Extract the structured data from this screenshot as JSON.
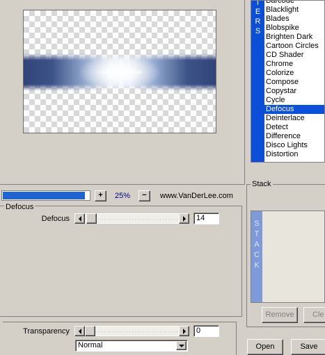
{
  "preview": {
    "band_colors": {
      "dark": "#31447a",
      "mid": "#8aa0c8",
      "highlight": "#ffffff"
    }
  },
  "filter_list": {
    "side_letters": [
      "T",
      "E",
      "R",
      "S"
    ],
    "items": [
      "Barcode",
      "Blacklight",
      "Blades",
      "Blobspike",
      "Brighten Dark",
      "Cartoon Circles",
      "CD Shader",
      "Chrome",
      "Colorize",
      "Compose",
      "Copystar",
      "Cycle",
      "Defocus",
      "Deinterlace",
      "Detect",
      "Difference",
      "Disco Lights",
      "Distortion"
    ],
    "selected": "Defocus",
    "accent_color": "#0a50dc"
  },
  "toolbar": {
    "progress": 0.95,
    "zoom_in_label": "+",
    "zoom_value": "25%",
    "zoom_out_label": "−",
    "website": "www.VanDerLee.com"
  },
  "defocus": {
    "group_title": "Defocus",
    "param_label": "Defocus",
    "slider_value": 0.02,
    "field_value": "14"
  },
  "bottom": {
    "transparency_label": "Transparency",
    "transparency_slider": 0.0,
    "transparency_value": "0",
    "blend_mode": "Normal"
  },
  "stack": {
    "title": "Stack",
    "side_letters": [
      "S",
      "T",
      "A",
      "C",
      "K"
    ],
    "remove_label": "Remove",
    "clear_label": "Cle",
    "open_label": "Open",
    "save_label": "Save"
  }
}
